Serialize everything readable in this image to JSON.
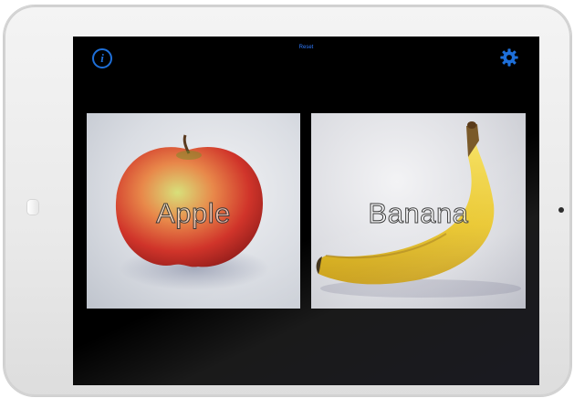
{
  "toolbar": {
    "info_icon": "info-circle-icon",
    "info_glyph": "i",
    "reset_label": "Reset",
    "settings_icon": "gear-icon",
    "accent_color": "#1e6fd9"
  },
  "cards": [
    {
      "label": "Apple",
      "image": "apple-photo"
    },
    {
      "label": "Banana",
      "image": "banana-photo"
    }
  ],
  "colors": {
    "screen_background": "#000000",
    "device_frame": "#ececec"
  }
}
